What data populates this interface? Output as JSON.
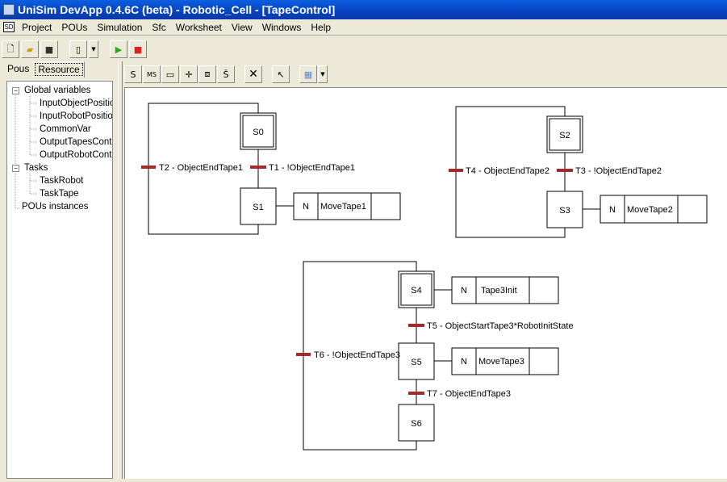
{
  "window": {
    "title": "UniSim DevApp 0.4.6C (beta) - Robotic_Cell  - [TapeControl]"
  },
  "menu": [
    "Project",
    "POUs",
    "Simulation",
    "Sfc",
    "Worksheet",
    "View",
    "Windows",
    "Help"
  ],
  "toolbar": {
    "buttons": [
      "new-file-icon",
      "open-folder-icon",
      "save-icon",
      "pou-icon",
      "run-simulation-icon",
      "stop-simulation-icon"
    ]
  },
  "left_panel": {
    "tabs": [
      "Pous",
      "Resource"
    ],
    "active_tab": "Resource",
    "tree": {
      "global_variables": "Global variables",
      "vars": [
        "InputObjectPosition",
        "InputRobotPosition",
        "CommonVar",
        "OutputTapesControl",
        "OutputRobotControl"
      ],
      "tasks": "Tasks",
      "task_items": [
        "TaskRobot",
        "TaskTape"
      ],
      "pou_instances": "POUs instances"
    }
  },
  "sfc_toolbar": {
    "buttons": [
      "S",
      "MS",
      "action",
      "transition",
      "initial-step",
      "jump",
      "delete",
      "select",
      "format"
    ]
  },
  "sfc": {
    "steps": {
      "s0": "S0",
      "s1": "S1",
      "s2": "S2",
      "s3": "S3",
      "s4": "S4",
      "s5": "S5",
      "s6": "S6"
    },
    "transitions": {
      "t1": "T1 - !ObjectEndTape1",
      "t2": "T2 - ObjectEndTape1",
      "t3": "T3 - !ObjectEndTape2",
      "t4": "T4 - ObjectEndTape2",
      "t5": "T5 - ObjectStartTape3*RobotInitState",
      "t6": "T6 - !ObjectEndTape3",
      "t7": "T7 - ObjectEndTape3"
    },
    "actions": {
      "a1": {
        "qualifier": "N",
        "name": "MoveTape1"
      },
      "a2": {
        "qualifier": "N",
        "name": "MoveTape2"
      },
      "a3": {
        "qualifier": "N",
        "name": "Tape3Init"
      },
      "a4": {
        "qualifier": "N",
        "name": "MoveTape3"
      }
    },
    "transition_color": "#a52a2a"
  }
}
